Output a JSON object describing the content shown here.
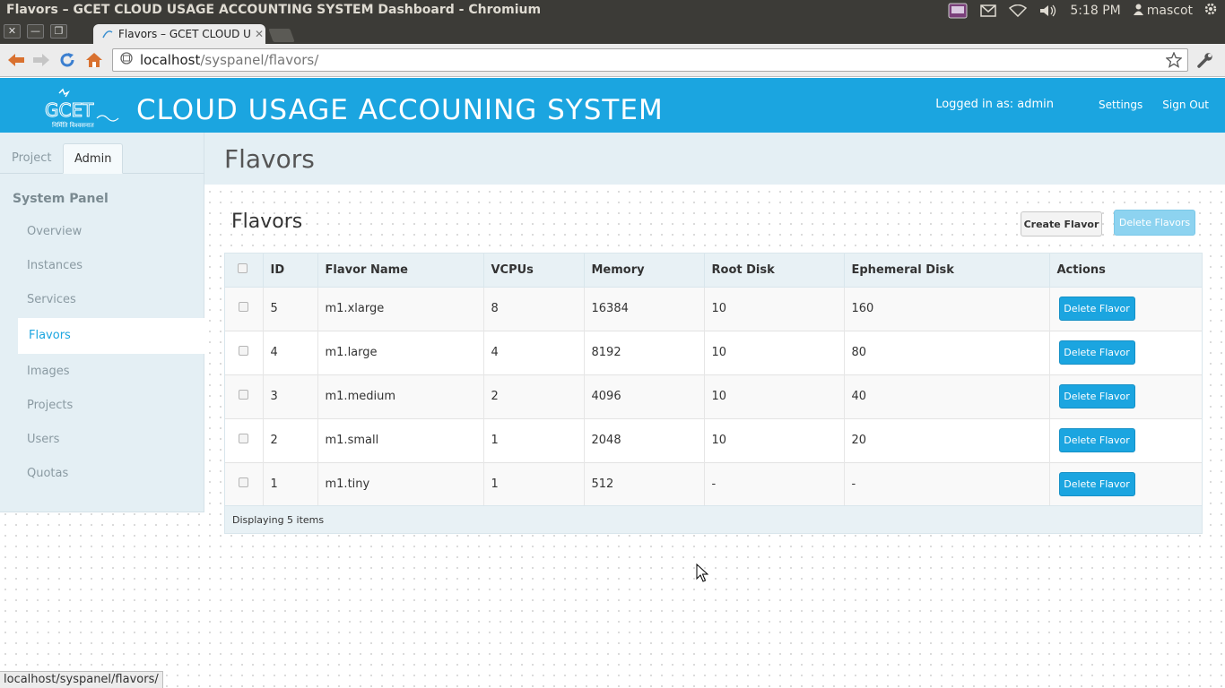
{
  "os": {
    "window_title": "Flavors – GCET CLOUD USAGE ACCOUNTING SYSTEM Dashboard - Chromium",
    "clock": "5:18 PM",
    "user": "mascot",
    "icons": [
      "indicator-applet-icon",
      "mail-icon",
      "wifi-icon",
      "volume-icon",
      "user-icon",
      "power-gear-icon"
    ]
  },
  "browser": {
    "tab_title": "Flavors – GCET CLOUD USAGE ACCOUNTING SYSTEM",
    "url_host": "localhost",
    "url_path": "/syspanel/flavors/",
    "status_url": "localhost/syspanel/flavors/"
  },
  "header": {
    "logo_text": "GCET",
    "logo_subtext": "निर्मिति विश्वसनात",
    "brand": "CLOUD USAGE ACCOUNING SYSTEM",
    "logged_in": "Logged in as: admin",
    "settings": "Settings",
    "sign_out": "Sign Out"
  },
  "sidebar": {
    "tabs": [
      "Project",
      "Admin"
    ],
    "active_tab": "Admin",
    "heading": "System Panel",
    "items": [
      "Overview",
      "Instances",
      "Services",
      "Flavors",
      "Images",
      "Projects",
      "Users",
      "Quotas"
    ],
    "active_item": "Flavors"
  },
  "main": {
    "page_title": "Flavors",
    "section_title": "Flavors",
    "create_button": "Create Flavor",
    "delete_all_button": "Delete Flavors",
    "columns": [
      "ID",
      "Flavor Name",
      "VCPUs",
      "Memory",
      "Root Disk",
      "Ephemeral Disk",
      "Actions"
    ],
    "rows": [
      {
        "id": "5",
        "name": "m1.xlarge",
        "vcpus": "8",
        "memory": "16384",
        "root_disk": "10",
        "ephemeral_disk": "160",
        "action": "Delete Flavor"
      },
      {
        "id": "4",
        "name": "m1.large",
        "vcpus": "4",
        "memory": "8192",
        "root_disk": "10",
        "ephemeral_disk": "80",
        "action": "Delete Flavor"
      },
      {
        "id": "3",
        "name": "m1.medium",
        "vcpus": "2",
        "memory": "4096",
        "root_disk": "10",
        "ephemeral_disk": "40",
        "action": "Delete Flavor"
      },
      {
        "id": "2",
        "name": "m1.small",
        "vcpus": "1",
        "memory": "2048",
        "root_disk": "10",
        "ephemeral_disk": "20",
        "action": "Delete Flavor"
      },
      {
        "id": "1",
        "name": "m1.tiny",
        "vcpus": "1",
        "memory": "512",
        "root_disk": "-",
        "ephemeral_disk": "-",
        "action": "Delete Flavor"
      }
    ],
    "footer": "Displaying 5 items"
  },
  "colors": {
    "brand_blue": "#1ba5e0",
    "sidebar_bg": "#e4eff4",
    "os_bar": "#3c3b37"
  }
}
